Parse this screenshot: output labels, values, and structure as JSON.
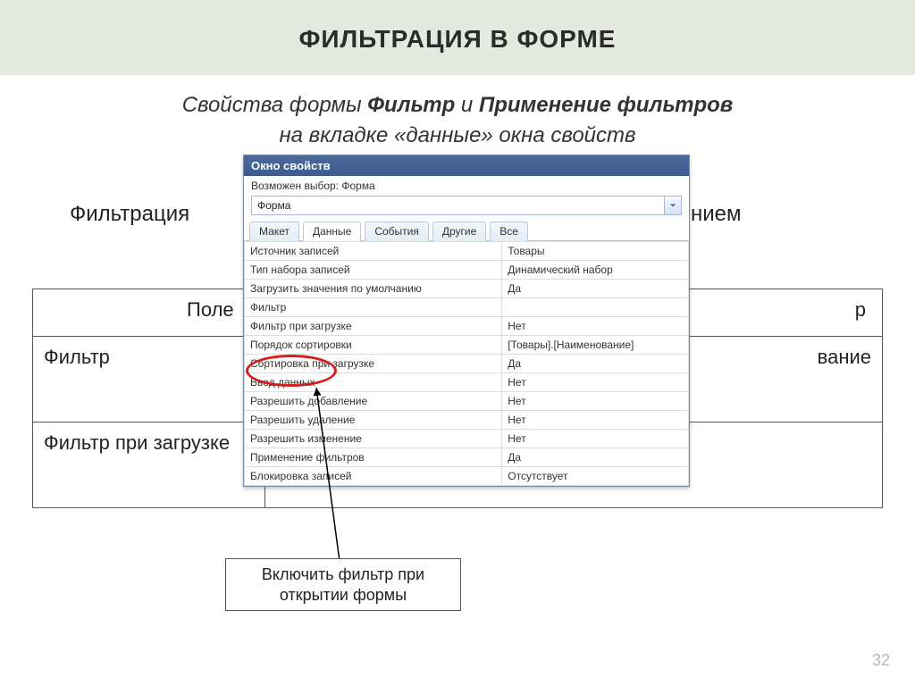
{
  "slide": {
    "title": "ФИЛЬТРАЦИЯ В ФОРМЕ",
    "subtitle_prefix": "Свойства формы ",
    "subtitle_b1": "Фильтр",
    "subtitle_mid": " и ",
    "subtitle_b2": "Применение фильтров",
    "subtitle_line2": "на вкладке «данные» окна свойств",
    "subtext_left": "Фильтрация",
    "subtext_right": "нием",
    "number": "32"
  },
  "bg_table": {
    "header_left": "Поле",
    "header_right_frag": "р",
    "row1_left": "Фильтр",
    "row1_right_frag": "вание",
    "row2_left": "Фильтр при загрузке"
  },
  "propwin": {
    "title": "Окно свойств",
    "selection": "Возможен выбор: Форма",
    "dropdown_value": "Форма",
    "tabs": [
      "Макет",
      "Данные",
      "События",
      "Другие",
      "Все"
    ],
    "active_tab": 1,
    "rows": [
      {
        "k": "Источник записей",
        "v": "Товары"
      },
      {
        "k": "Тип набора записей",
        "v": "Динамический набор"
      },
      {
        "k": "Загрузить значения по умолчанию",
        "v": "Да"
      },
      {
        "k": "Фильтр",
        "v": ""
      },
      {
        "k": "Фильтр при загрузке",
        "v": "Нет"
      },
      {
        "k": "Порядок сортировки",
        "v": "[Товары].[Наименование]"
      },
      {
        "k": "Сортировка при загрузке",
        "v": "Да"
      },
      {
        "k": "Ввод данных",
        "v": "Нет"
      },
      {
        "k": "Разрешить добавление",
        "v": "Нет"
      },
      {
        "k": "Разрешить удаление",
        "v": "Нет"
      },
      {
        "k": "Разрешить изменение",
        "v": "Нет"
      },
      {
        "k": "Применение фильтров",
        "v": "Да"
      },
      {
        "k": "Блокировка записей",
        "v": "Отсутствует"
      }
    ]
  },
  "callout": {
    "text": "Включить фильтр при открытии формы"
  }
}
